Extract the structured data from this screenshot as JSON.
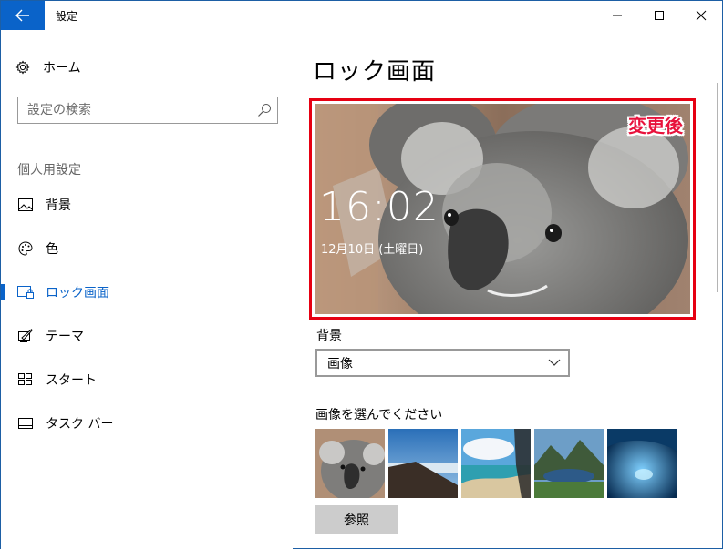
{
  "window": {
    "title": "設定",
    "accent_color": "#0a63c9"
  },
  "sidebar": {
    "home_label": "ホーム",
    "search_placeholder": "設定の検索",
    "section_header": "個人用設定",
    "items": [
      {
        "label": "背景",
        "icon": "picture-icon",
        "selected": false
      },
      {
        "label": "色",
        "icon": "palette-icon",
        "selected": false
      },
      {
        "label": "ロック画面",
        "icon": "lock-screen-icon",
        "selected": true
      },
      {
        "label": "テーマ",
        "icon": "theme-brush-icon",
        "selected": false
      },
      {
        "label": "スタート",
        "icon": "start-tiles-icon",
        "selected": false
      },
      {
        "label": "タスク バー",
        "icon": "taskbar-icon",
        "selected": false
      }
    ]
  },
  "main": {
    "page_title": "ロック画面",
    "preview": {
      "time": "16:02",
      "date": "12月10日 (土曜日)",
      "annotation": "変更後",
      "annotation_color": "#e8123c",
      "border_color": "#e60012"
    },
    "background_label": "背景",
    "background_value": "画像",
    "choose_image_label": "画像を選んでください",
    "thumbnails": [
      "koala",
      "cliff-horizon",
      "beach-lagoon",
      "mountain-lake",
      "ice-cave"
    ],
    "browse_label": "参照"
  }
}
